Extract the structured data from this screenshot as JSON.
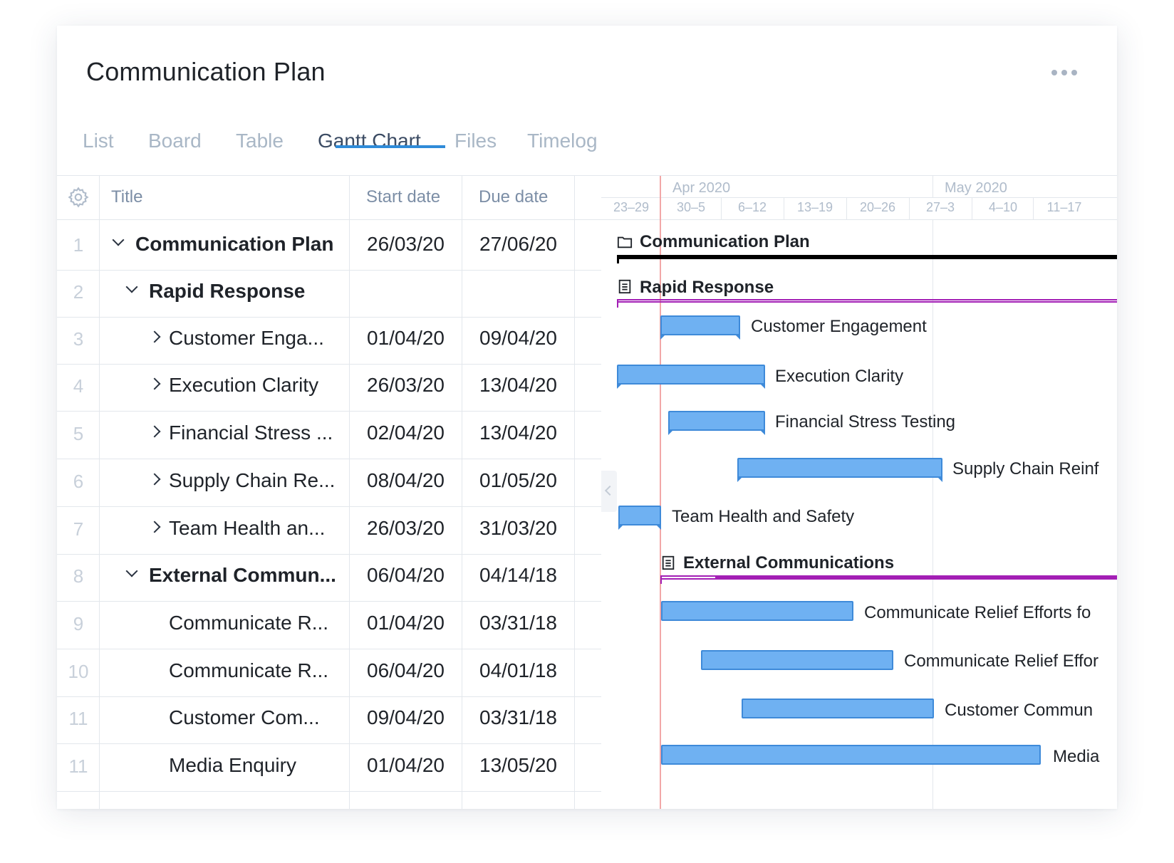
{
  "header": {
    "title": "Communication Plan"
  },
  "tabs": [
    {
      "label": "List"
    },
    {
      "label": "Board"
    },
    {
      "label": "Table"
    },
    {
      "label": "Gantt Chart"
    },
    {
      "label": "Files"
    },
    {
      "label": "Timelog"
    }
  ],
  "active_tab": "Gantt Chart",
  "grid": {
    "columns": {
      "title": "Title",
      "start": "Start date",
      "due": "Due date"
    },
    "rows": [
      {
        "num": "1",
        "title": "Communication Plan",
        "start": "26/03/20",
        "due": "27/06/20"
      },
      {
        "num": "2",
        "title": "Rapid Response",
        "start": "",
        "due": ""
      },
      {
        "num": "3",
        "title": "Customer Enga...",
        "start": "01/04/20",
        "due": "09/04/20"
      },
      {
        "num": "4",
        "title": "Execution Clarity",
        "start": "26/03/20",
        "due": "13/04/20"
      },
      {
        "num": "5",
        "title": "Financial Stress ...",
        "start": "02/04/20",
        "due": "13/04/20"
      },
      {
        "num": "6",
        "title": "Supply Chain Re...",
        "start": "08/04/20",
        "due": "01/05/20"
      },
      {
        "num": "7",
        "title": "Team Health an...",
        "start": "26/03/20",
        "due": "31/03/20"
      },
      {
        "num": "8",
        "title": "External Commun...",
        "start": "06/04/20",
        "due": "04/14/18"
      },
      {
        "num": "9",
        "title": "Communicate R...",
        "start": "01/04/20",
        "due": "03/31/18"
      },
      {
        "num": "10",
        "title": "Communicate R...",
        "start": "06/04/20",
        "due": "04/01/18"
      },
      {
        "num": "11",
        "title": "Customer Com...",
        "start": "09/04/20",
        "due": "03/31/18"
      },
      {
        "num": "11",
        "title": "Media Enquiry",
        "start": "01/04/20",
        "due": "13/05/20"
      }
    ]
  },
  "gantt": {
    "months": [
      {
        "label": "Apr 2020"
      },
      {
        "label": "May 2020"
      }
    ],
    "weeks": [
      {
        "label": "23–29"
      },
      {
        "label": "30–5"
      },
      {
        "label": "6–12"
      },
      {
        "label": "13–19"
      },
      {
        "label": "20–26"
      },
      {
        "label": "27–3"
      },
      {
        "label": "4–10"
      },
      {
        "label": "11–17"
      }
    ],
    "labels": {
      "project": "Communication Plan",
      "group1": "Rapid Response",
      "t3": "Customer Engagement",
      "t4": "Execution Clarity",
      "t5": "Financial Stress Testing",
      "t6": "Supply Chain Reinf",
      "t7": "Team Health and Safety",
      "group2": "External Communications",
      "t9": "Communicate Relief Efforts fo",
      "t10": "Communicate Relief Effor",
      "t11": "Customer Commun",
      "t12": "Media"
    }
  },
  "colors": {
    "accent": "#2f8bd8",
    "bar_fill": "#6fb1f2",
    "bar_border": "#3e8ad9",
    "group_line": "#a31fb5",
    "project_line": "#000000",
    "today_line": "#f2a7a7"
  },
  "icons": [
    "gear-icon",
    "more-dots-icon",
    "folder-icon",
    "clipboard-icon",
    "chevron-down-icon",
    "chevron-right-icon"
  ]
}
